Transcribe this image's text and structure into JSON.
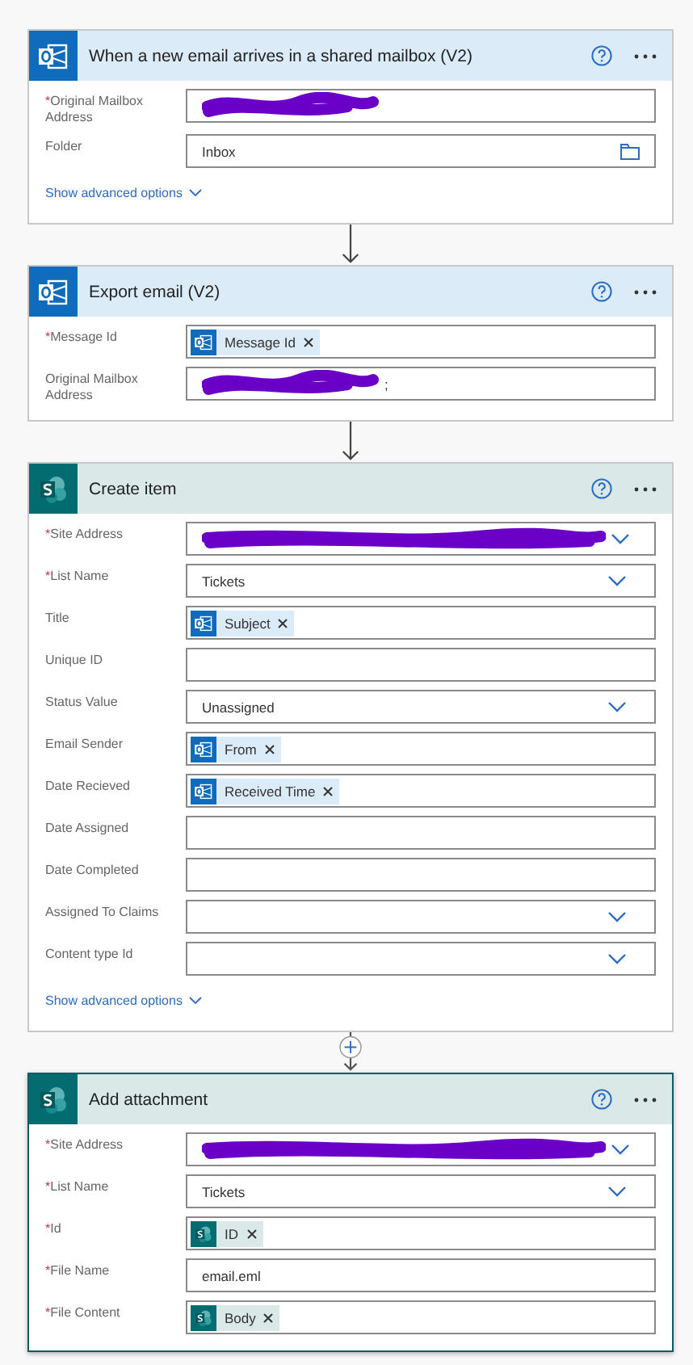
{
  "cards": [
    {
      "title": "When a new email arrives in a shared mailbox (V2)",
      "kind": "outlook",
      "selected": false,
      "connector": {
        "kind": "arrow"
      },
      "advanced_link": "Show advanced options",
      "fields": [
        {
          "marker": "*",
          "label": "Original Mailbox Address",
          "kind": "redacted"
        },
        {
          "label": "Folder",
          "kind": "text",
          "value": "Inbox",
          "adornment": {
            "kind": "folder"
          }
        }
      ]
    },
    {
      "title": "Export email (V2)",
      "kind": "outlook",
      "selected": false,
      "connector": {
        "kind": "arrow"
      },
      "fields": [
        {
          "marker": "*",
          "label": "Message Id",
          "kind": "token",
          "tokens": [
            {
              "label": "Message Id",
              "kind": "outlook"
            }
          ]
        },
        {
          "label": "Original Mailbox Address",
          "kind": "redacted",
          "value": ";"
        }
      ]
    },
    {
      "title": "Create item",
      "kind": "sharepoint",
      "selected": false,
      "connector": {
        "kind": "add"
      },
      "advanced_link": "Show advanced options",
      "fields": [
        {
          "marker": "*",
          "label": "Site Address",
          "kind": "redacted",
          "adornment": {
            "kind": "chevron"
          }
        },
        {
          "marker": "*",
          "label": "List Name",
          "kind": "text",
          "value": "Tickets",
          "adornment": {
            "kind": "chevron"
          }
        },
        {
          "label": "Title",
          "kind": "token",
          "tokens": [
            {
              "label": "Subject",
              "kind": "outlook"
            }
          ]
        },
        {
          "label": "Unique ID",
          "kind": "text"
        },
        {
          "label": "Status Value",
          "kind": "text",
          "value": "Unassigned",
          "adornment": {
            "kind": "chevron"
          }
        },
        {
          "label": "Email Sender",
          "kind": "token",
          "tokens": [
            {
              "label": "From",
              "kind": "outlook"
            }
          ]
        },
        {
          "label": "Date Recieved",
          "kind": "token",
          "tokens": [
            {
              "label": "Received Time",
              "kind": "outlook"
            }
          ]
        },
        {
          "label": "Date Assigned",
          "kind": "text"
        },
        {
          "label": "Date Completed",
          "kind": "text"
        },
        {
          "label": "Assigned To Claims",
          "kind": "text",
          "adornment": {
            "kind": "chevron"
          }
        },
        {
          "label": "Content type Id",
          "kind": "text",
          "adornment": {
            "kind": "chevron"
          }
        }
      ]
    },
    {
      "title": "Add attachment",
      "kind": "sharepoint",
      "selected": true,
      "fields": [
        {
          "marker": "*",
          "label": "Site Address",
          "kind": "redacted",
          "adornment": {
            "kind": "chevron"
          }
        },
        {
          "marker": "*",
          "label": "List Name",
          "kind": "text",
          "value": "Tickets",
          "adornment": {
            "kind": "chevron"
          }
        },
        {
          "marker": "*",
          "label": "Id",
          "kind": "token",
          "tokens": [
            {
              "label": "ID",
              "kind": "sharepoint"
            }
          ]
        },
        {
          "marker": "*",
          "label": "File Name",
          "kind": "text",
          "value": "email.eml"
        },
        {
          "marker": "*",
          "label": "File Content",
          "kind": "token",
          "tokens": [
            {
              "label": "Body",
              "kind": "sharepoint"
            }
          ]
        }
      ]
    }
  ]
}
